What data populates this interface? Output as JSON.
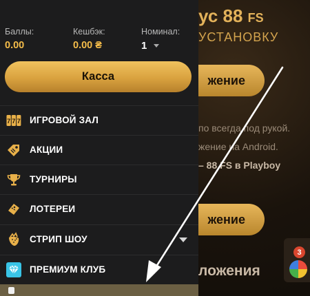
{
  "background": {
    "promo_title_main": "ус 88",
    "promo_title_fs": "FS",
    "promo_subtitle": "УСТАНОВКУ",
    "button_1_label": "жение",
    "text_line_1": "по всегда под рукой.",
    "text_line_2": "жение на Android.",
    "text_line_3": "– 88 FS в Playboy",
    "button_2_label": "жение",
    "apps_heading": "ложения",
    "widget_badge_count": "3"
  },
  "menu": {
    "balance": {
      "label": "Баллы:",
      "value": "0.00"
    },
    "cashback": {
      "label": "Кешбэк:",
      "value": "0.00 ₴"
    },
    "nominal": {
      "label": "Номинал:",
      "value": "1"
    },
    "cashier_button": "Касса",
    "items": [
      {
        "label": "ИГРОВОЙ ЗАЛ",
        "icon": "slot-777-icon"
      },
      {
        "label": "АКЦИИ",
        "icon": "ticket-tag-icon"
      },
      {
        "label": "ТУРНИРЫ",
        "icon": "trophy-icon"
      },
      {
        "label": "ЛОТЕРЕИ",
        "icon": "lottery-ticket-icon"
      },
      {
        "label": "СТРИП ШОУ",
        "icon": "strawberry-icon",
        "expandable": true
      },
      {
        "label": "ПРЕМИУМ КЛУБ",
        "icon": "diamond-icon"
      }
    ]
  },
  "colors": {
    "menu_bg": "#1c1c1d",
    "accent_gold": "#f4bc4a",
    "cashier_gradient_top": "#f0c25e",
    "cashier_gradient_bottom": "#b7812c",
    "menu_text": "#ffffff",
    "annotation_arrow": "#ffffff"
  }
}
